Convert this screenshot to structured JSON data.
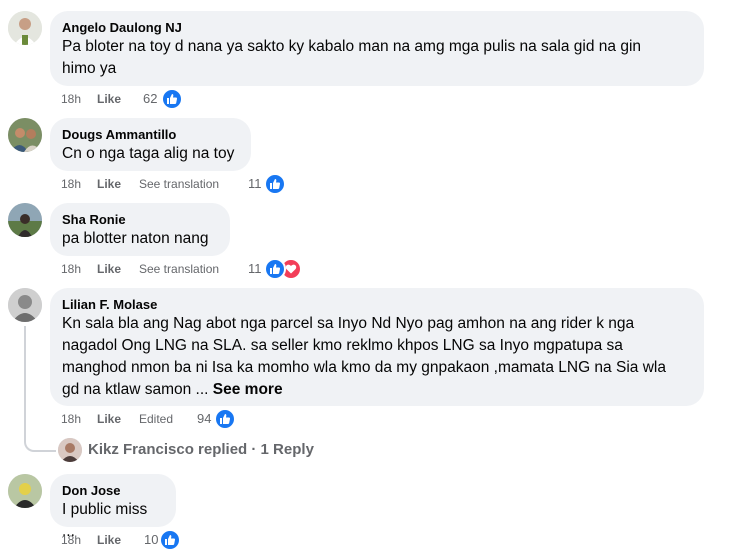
{
  "comments": [
    {
      "author": "Angelo Daulong NJ",
      "lines": [
        "Pa bloter na toy d nana ya sakto ky kabalo man na amg mga pulis na sala gid na gin",
        "himo ya"
      ],
      "time": "18h",
      "like_label": "Like",
      "reaction_count": "62"
    },
    {
      "author": "Dougs Ammantillo",
      "lines": [
        "Cn o nga taga alig na toy"
      ],
      "time": "18h",
      "like_label": "Like",
      "translation_label": "See translation",
      "reaction_count": "11"
    },
    {
      "author": "Sha Ronie",
      "lines": [
        "pa blotter naton nang"
      ],
      "time": "18h",
      "like_label": "Like",
      "translation_label": "See translation",
      "reaction_count": "11"
    },
    {
      "author": "Lilian F. Molase",
      "lines": [
        "Kn sala bla ang Nag abot nga parcel sa Inyo Nd Nyo pag amhon na ang rider k nga",
        "nagadol Ong LNG na SLA. sa seller kmo reklmo khpos LNG sa Inyo mgpatupa sa",
        "manghod nmon ba ni Isa ka momho wla kmo da my gnpakaon ,mamata LNG na Sia wla",
        "gd na ktlaw samon ..."
      ],
      "see_more": "See more",
      "time": "18h",
      "like_label": "Like",
      "edited_label": "Edited",
      "reaction_count": "94",
      "reply": {
        "text": "Kikz Francisco replied · 1 Reply"
      }
    },
    {
      "author": "Don Jose",
      "lines": [
        "I public miss ..."
      ],
      "time": "18h",
      "like_label": "Like",
      "reaction_count": "10"
    }
  ],
  "colors": {
    "bubble": "#f0f2f5",
    "like_blue": "#1877f2",
    "heart_red": "#f33e58",
    "meta_gray": "#65676b"
  },
  "icons": [
    "like-reaction-icon",
    "love-reaction-icon"
  ]
}
